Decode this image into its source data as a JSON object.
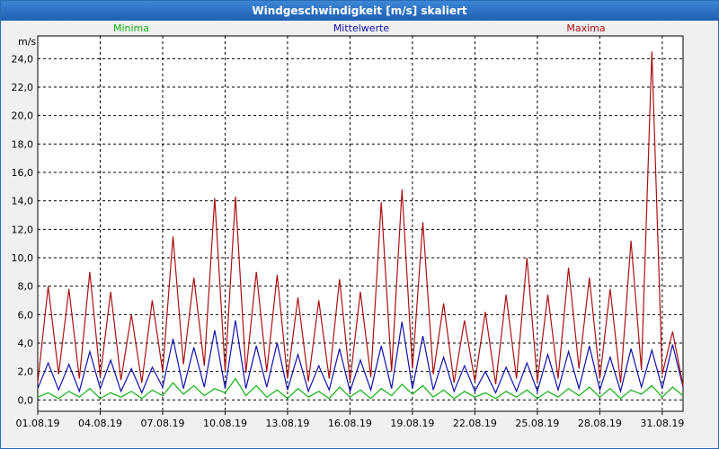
{
  "window": {
    "title": "Windgeschwindigkeit [m/s] skaliert"
  },
  "chart_data": {
    "type": "line",
    "title": "Windgeschwindigkeit [m/s] skaliert",
    "ylabel": "m/s",
    "xlabel": "",
    "ylim": [
      -0.8,
      25.6
    ],
    "xlim": [
      0,
      31
    ],
    "grid": true,
    "legend_position": "top",
    "x_ticks": [
      {
        "x": 0,
        "label": "01.08.19"
      },
      {
        "x": 3,
        "label": "04.08.19"
      },
      {
        "x": 6,
        "label": "07.08.19"
      },
      {
        "x": 9,
        "label": "10.08.19"
      },
      {
        "x": 12,
        "label": "13.08.19"
      },
      {
        "x": 15,
        "label": "16.08.19"
      },
      {
        "x": 18,
        "label": "19.08.19"
      },
      {
        "x": 21,
        "label": "22.08.19"
      },
      {
        "x": 24,
        "label": "25.08.19"
      },
      {
        "x": 27,
        "label": "28.08.19"
      },
      {
        "x": 30,
        "label": "31.08.19"
      }
    ],
    "y_ticks": [
      {
        "v": 0,
        "label": "0,0"
      },
      {
        "v": 2,
        "label": "2,0"
      },
      {
        "v": 4,
        "label": "4,0"
      },
      {
        "v": 6,
        "label": "6,0"
      },
      {
        "v": 8,
        "label": "8,0"
      },
      {
        "v": 10,
        "label": "10,0"
      },
      {
        "v": 12,
        "label": "12,0"
      },
      {
        "v": 14,
        "label": "14,0"
      },
      {
        "v": 16,
        "label": "16,0"
      },
      {
        "v": 18,
        "label": "18,0"
      },
      {
        "v": 20,
        "label": "20,0"
      },
      {
        "v": 22,
        "label": "22,0"
      },
      {
        "v": 24,
        "label": "24,0"
      }
    ],
    "series": [
      {
        "name": "Minima",
        "color": "#11b011",
        "legend_align": "left",
        "x": [
          0,
          0.5,
          1,
          1.5,
          2,
          2.5,
          3,
          3.5,
          4,
          4.5,
          5,
          5.5,
          6,
          6.5,
          7,
          7.5,
          8,
          8.5,
          9,
          9.5,
          10,
          10.5,
          11,
          11.5,
          12,
          12.5,
          13,
          13.5,
          14,
          14.5,
          15,
          15.5,
          16,
          16.5,
          17,
          17.5,
          18,
          18.5,
          19,
          19.5,
          20,
          20.5,
          21,
          21.5,
          22,
          22.5,
          23,
          23.5,
          24,
          24.5,
          25,
          25.5,
          26,
          26.5,
          27,
          27.5,
          28,
          28.5,
          29,
          29.5,
          30,
          30.5,
          31
        ],
        "values": [
          0.2,
          0.5,
          0.1,
          0.6,
          0.2,
          0.8,
          0.1,
          0.5,
          0.2,
          0.6,
          0.1,
          0.7,
          0.3,
          1.2,
          0.4,
          1.0,
          0.3,
          0.8,
          0.5,
          1.5,
          0.3,
          1.0,
          0.2,
          0.7,
          0.1,
          0.8,
          0.2,
          0.6,
          0.1,
          0.9,
          0.2,
          0.7,
          0.1,
          0.8,
          0.3,
          1.1,
          0.4,
          1.0,
          0.2,
          0.7,
          0.1,
          0.6,
          0.2,
          0.5,
          0.1,
          0.6,
          0.2,
          0.7,
          0.1,
          0.6,
          0.2,
          0.8,
          0.3,
          0.9,
          0.2,
          0.8,
          0.1,
          0.7,
          0.4,
          1.0,
          0.2,
          0.9,
          0.3
        ]
      },
      {
        "name": "Mittelwerte",
        "color": "#1111aa",
        "legend_align": "center",
        "x": [
          0,
          0.5,
          1,
          1.5,
          2,
          2.5,
          3,
          3.5,
          4,
          4.5,
          5,
          5.5,
          6,
          6.5,
          7,
          7.5,
          8,
          8.5,
          9,
          9.5,
          10,
          10.5,
          11,
          11.5,
          12,
          12.5,
          13,
          13.5,
          14,
          14.5,
          15,
          15.5,
          16,
          16.5,
          17,
          17.5,
          18,
          18.5,
          19,
          19.5,
          20,
          20.5,
          21,
          21.5,
          22,
          22.5,
          23,
          23.5,
          24,
          24.5,
          25,
          25.5,
          26,
          26.5,
          27,
          27.5,
          28,
          28.5,
          29,
          29.5,
          30,
          30.5,
          31
        ],
        "values": [
          0.8,
          2.6,
          0.7,
          2.5,
          0.6,
          3.4,
          0.8,
          2.8,
          0.6,
          2.2,
          0.5,
          2.3,
          0.9,
          4.3,
          0.8,
          3.7,
          0.9,
          4.9,
          0.8,
          5.6,
          0.8,
          3.8,
          0.9,
          4.0,
          0.7,
          3.2,
          0.6,
          2.4,
          0.7,
          3.6,
          0.6,
          2.8,
          0.7,
          3.8,
          0.8,
          5.5,
          0.8,
          4.5,
          0.7,
          3.0,
          0.6,
          2.4,
          0.6,
          2.0,
          0.5,
          2.3,
          0.6,
          2.6,
          0.6,
          3.2,
          0.7,
          3.4,
          0.8,
          3.8,
          0.7,
          3.0,
          0.6,
          3.6,
          0.9,
          3.5,
          0.8,
          3.9,
          0.9
        ]
      },
      {
        "name": "Maxima",
        "color": "#aa1111",
        "legend_align": "right",
        "x": [
          0,
          0.5,
          1,
          1.5,
          2,
          2.5,
          3,
          3.5,
          4,
          4.5,
          5,
          5.5,
          6,
          6.5,
          7,
          7.5,
          8,
          8.5,
          9,
          9.5,
          10,
          10.5,
          11,
          11.5,
          12,
          12.5,
          13,
          13.5,
          14,
          14.5,
          15,
          15.5,
          16,
          16.5,
          17,
          17.5,
          18,
          18.5,
          19,
          19.5,
          20,
          20.5,
          21,
          21.5,
          22,
          22.5,
          23,
          23.5,
          24,
          24.5,
          25,
          25.5,
          26,
          26.5,
          27,
          27.5,
          28,
          28.5,
          29,
          29.5,
          30,
          30.5,
          31
        ],
        "values": [
          1.2,
          8.0,
          1.8,
          7.8,
          1.5,
          9.0,
          1.6,
          7.6,
          1.4,
          6.0,
          1.2,
          7.0,
          2.0,
          11.5,
          2.5,
          8.6,
          2.4,
          14.2,
          2.0,
          14.3,
          1.9,
          9.0,
          2.0,
          8.8,
          1.5,
          7.2,
          1.3,
          7.0,
          1.5,
          8.5,
          1.3,
          7.6,
          1.6,
          13.9,
          2.0,
          14.8,
          2.2,
          12.5,
          1.8,
          6.8,
          1.2,
          5.6,
          1.3,
          6.2,
          1.1,
          7.4,
          1.5,
          10.0,
          1.3,
          7.4,
          1.5,
          9.3,
          2.2,
          8.6,
          1.5,
          7.8,
          1.2,
          11.2,
          2.1,
          24.5,
          1.8,
          4.8,
          1.0
        ]
      }
    ]
  }
}
